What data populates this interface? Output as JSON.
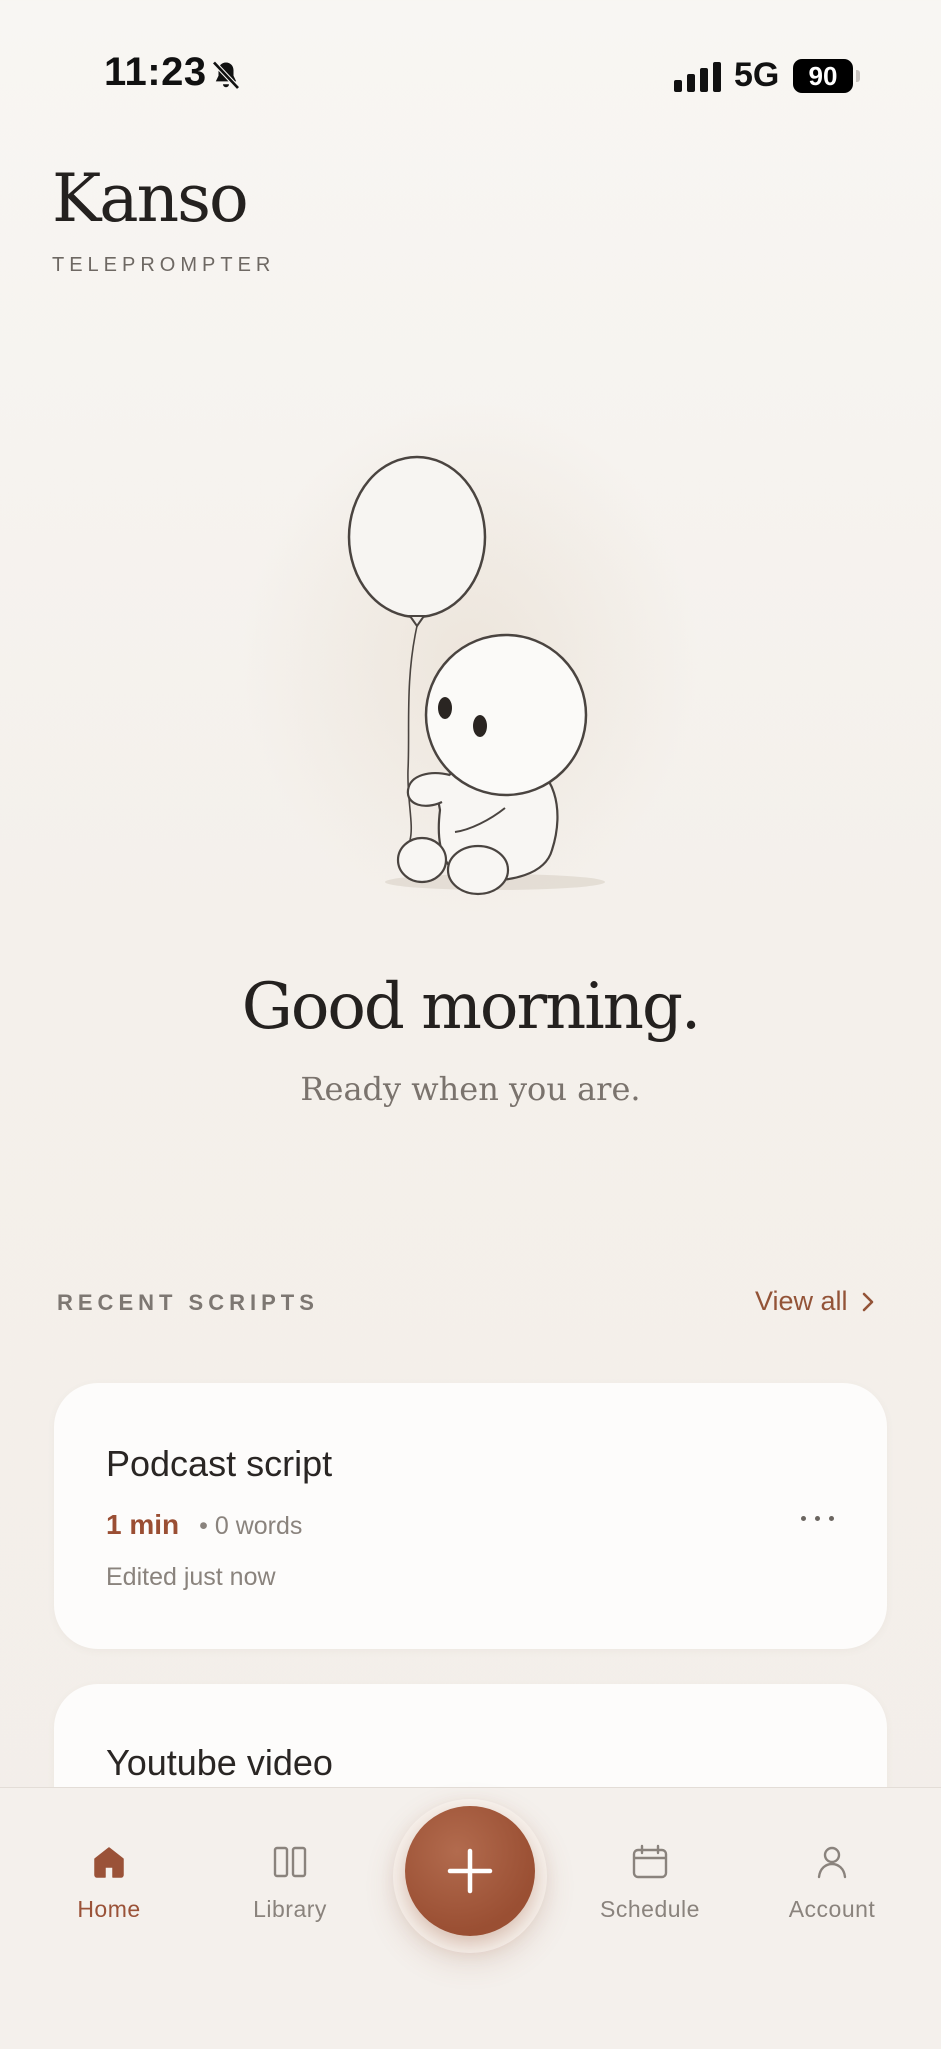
{
  "status_bar": {
    "time": "11:23",
    "network": "5G",
    "battery": "90",
    "icons": [
      "bell-slash-icon",
      "signal-bars-icon",
      "battery-icon"
    ]
  },
  "brand": {
    "title": "Kanso",
    "subtitle": "TELEPROMPTER"
  },
  "hero": {
    "illustration": "balloon-character-illustration"
  },
  "greeting": {
    "title": "Good morning.",
    "subtitle": "Ready when you are."
  },
  "recent_scripts": {
    "header": "RECENT SCRIPTS",
    "view_all": "View all",
    "items": [
      {
        "title": "Podcast script",
        "duration": "1 min",
        "words": "• 0 words",
        "edited": "Edited just now"
      },
      {
        "title": "Youtube video"
      }
    ]
  },
  "tab_bar": {
    "items": [
      {
        "label": "Home",
        "icon": "home-icon",
        "active": true
      },
      {
        "label": "Library",
        "icon": "library-icon",
        "active": false
      },
      {
        "label": "Schedule",
        "icon": "calendar-icon",
        "active": false
      },
      {
        "label": "Account",
        "icon": "person-icon",
        "active": false
      }
    ],
    "fab_icon": "plus-icon"
  },
  "colors": {
    "accent": "#9a4f33",
    "background": "#f4f0eb",
    "card": "#fdfcfb",
    "text_primary": "#2a2624",
    "text_secondary": "#8a837d"
  }
}
